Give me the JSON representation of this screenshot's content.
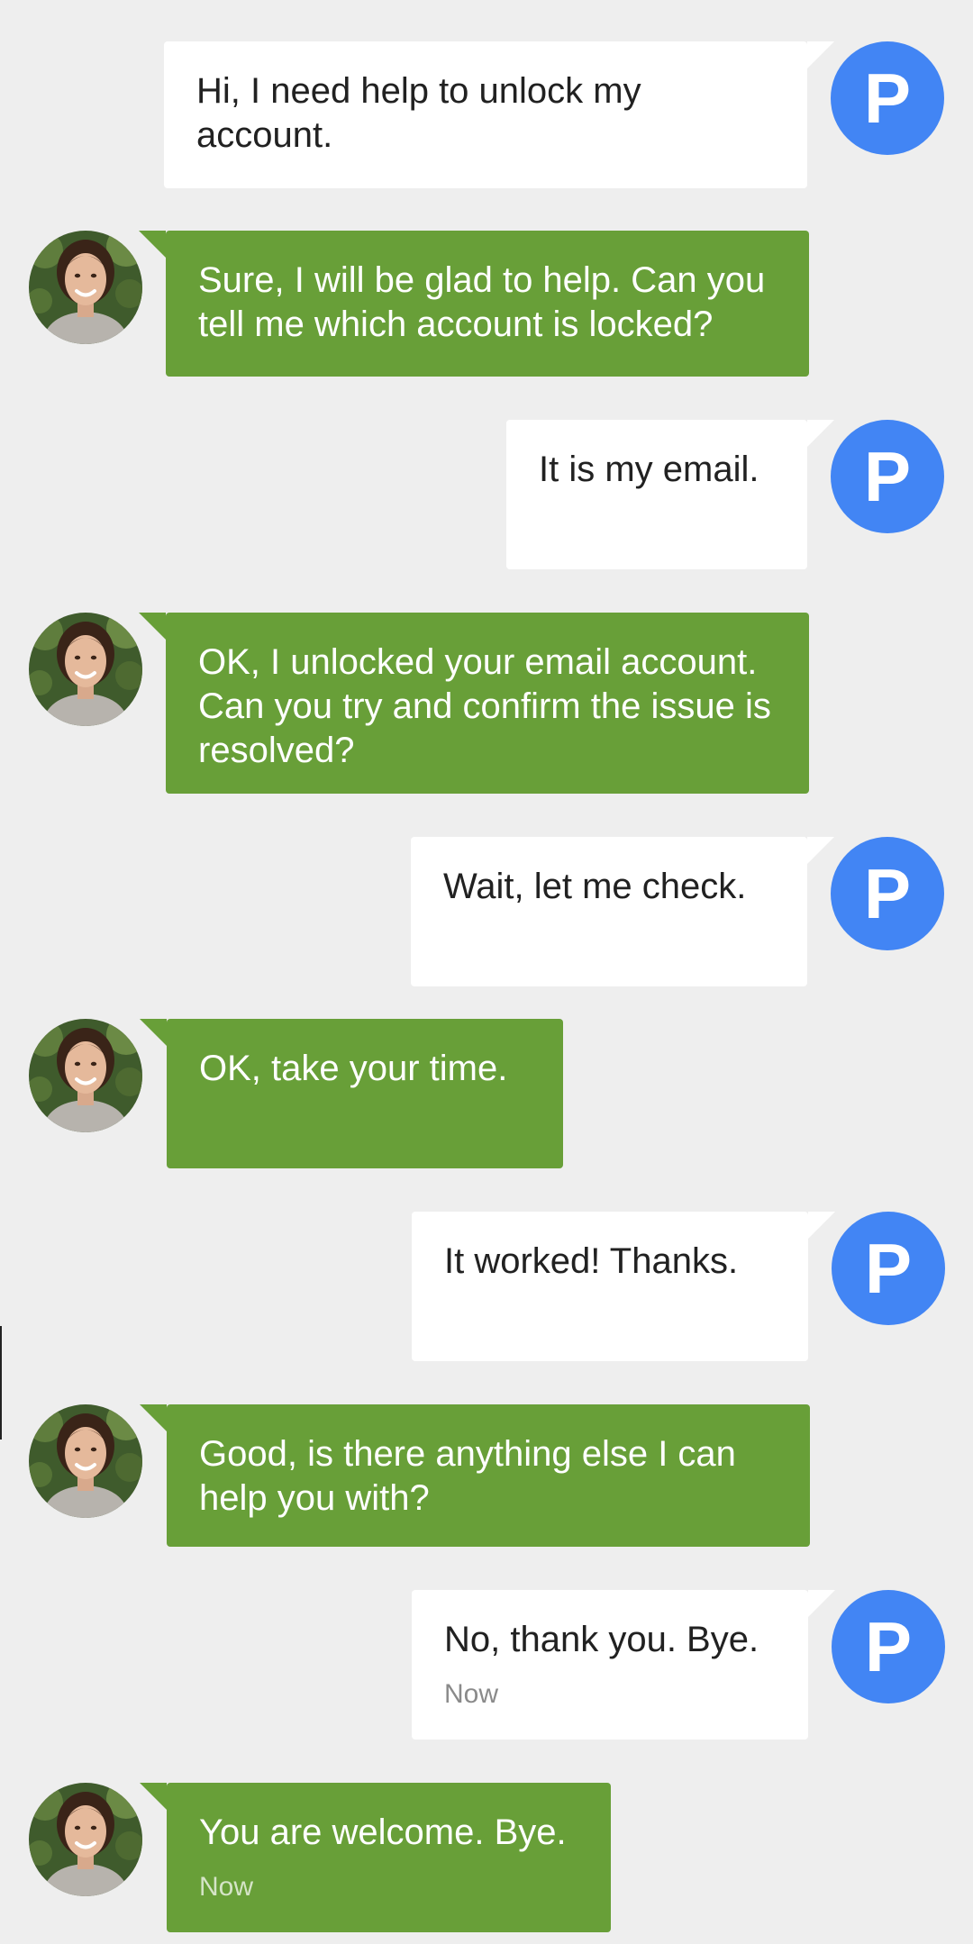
{
  "user_avatar_letter": "P",
  "colors": {
    "user_bubble": "#ffffff",
    "agent_bubble": "#689f38",
    "user_avatar": "#4285f4",
    "background": "#eeeeee"
  },
  "messages": [
    {
      "sender": "user",
      "text": "Hi, I need help to unlock my account.",
      "time": ""
    },
    {
      "sender": "agent",
      "text": "Sure, I will be glad to help. Can you tell me which account is locked?",
      "time": ""
    },
    {
      "sender": "user",
      "text": "It is my email.",
      "time": ""
    },
    {
      "sender": "agent",
      "text": "OK, I unlocked your email account. Can you try and confirm the issue is resolved?",
      "time": ""
    },
    {
      "sender": "user",
      "text": "Wait, let me check.",
      "time": ""
    },
    {
      "sender": "agent",
      "text": "OK, take your time.",
      "time": ""
    },
    {
      "sender": "user",
      "text": "It worked! Thanks.",
      "time": ""
    },
    {
      "sender": "agent",
      "text": "Good, is there anything else I can help you with?",
      "time": ""
    },
    {
      "sender": "user",
      "text": "No, thank you. Bye.",
      "time": "Now"
    },
    {
      "sender": "agent",
      "text": "You are welcome. Bye.",
      "time": "Now"
    }
  ]
}
